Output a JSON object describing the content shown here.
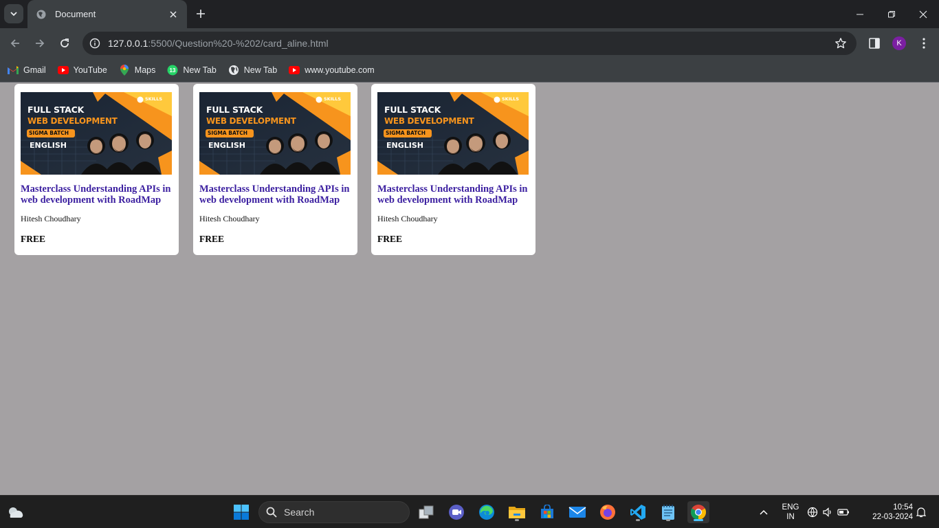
{
  "browser": {
    "tab": {
      "title": "Document"
    },
    "url": {
      "host": "127.0.0.1",
      "path": ":5500/Question%20-%202/card_aline.html"
    },
    "profile_initial": "K",
    "bookmarks": [
      {
        "label": "Gmail",
        "icon": "gmail-icon"
      },
      {
        "label": "YouTube",
        "icon": "youtube-icon"
      },
      {
        "label": "Maps",
        "icon": "maps-icon"
      },
      {
        "label": "New Tab",
        "icon": "whatsapp-icon",
        "badge": "13"
      },
      {
        "label": "New Tab",
        "icon": "globe-icon"
      },
      {
        "label": "www.youtube.com",
        "icon": "youtube-icon"
      }
    ]
  },
  "cards": [
    {
      "thumb": {
        "line1": "FULL STACK",
        "line2": "WEB DEVELOPMENT",
        "badge": "SIGMA BATCH",
        "lang": "ENGLISH",
        "brand": "SKILLS"
      },
      "title": "Masterclass Understanding APIs in web development with RoadMap",
      "author": "Hitesh Choudhary",
      "price": "FREE"
    },
    {
      "thumb": {
        "line1": "FULL STACK",
        "line2": "WEB DEVELOPMENT",
        "badge": "SIGMA BATCH",
        "lang": "ENGLISH",
        "brand": "SKILLS"
      },
      "title": "Masterclass Understanding APIs in web development with RoadMap",
      "author": "Hitesh Choudhary",
      "price": "FREE"
    },
    {
      "thumb": {
        "line1": "FULL STACK",
        "line2": "WEB DEVELOPMENT",
        "badge": "SIGMA BATCH",
        "lang": "ENGLISH",
        "brand": "SKILLS"
      },
      "title": "Masterclass Understanding APIs in web development with RoadMap",
      "author": "Hitesh Choudhary",
      "price": "FREE"
    }
  ],
  "taskbar": {
    "search_label": "Search",
    "language": {
      "line1": "ENG",
      "line2": "IN"
    },
    "time": "10:54",
    "date": "22-03-2024"
  },
  "colors": {
    "page_bg": "#a4a1a3",
    "card_title": "#3b1fa0",
    "thumb_accent": "#f7941d",
    "taskbar_active": "#4cc2ff"
  }
}
